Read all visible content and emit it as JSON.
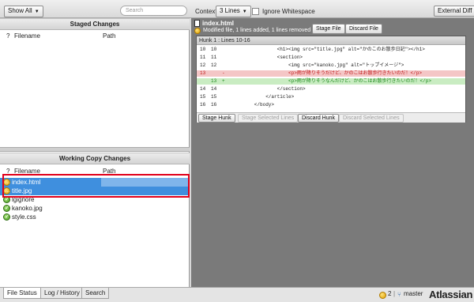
{
  "toolbar": {
    "show_filter": "Show All",
    "search_placeholder": "Search",
    "context_label": "Context:",
    "context_value": "3 Lines",
    "ignore_whitespace_label": "Ignore Whitespace",
    "external_diff_label": "External Diff"
  },
  "staged": {
    "title": "Staged Changes",
    "columns": {
      "q": "?",
      "filename": "Filename",
      "path": "Path"
    }
  },
  "working": {
    "title": "Working Copy Changes",
    "columns": {
      "q": "?",
      "filename": "Filename",
      "path": "Path"
    },
    "files": [
      {
        "name": "index.html",
        "status": "modified"
      },
      {
        "name": "title.jpg",
        "status": "modified"
      },
      {
        "name": "lgignore",
        "status": "clean"
      },
      {
        "name": "kanoko.jpg",
        "status": "clean"
      },
      {
        "name": "style.css",
        "status": "clean"
      }
    ]
  },
  "diff": {
    "file_name": "index.html",
    "summary": "Modified file, 1 lines added, 1 lines removed",
    "stage_file_label": "Stage File",
    "discard_file_label": "Discard File",
    "hunk_title": "Hunk 1 : Lines 10-16",
    "lines": [
      {
        "type": "context",
        "old": "10",
        "new": "10",
        "marker": "",
        "code": "                <h1><img src=\"title.jpg\" alt=\"かのこのお散歩日記\"></h1>"
      },
      {
        "type": "context",
        "old": "11",
        "new": "11",
        "marker": "",
        "code": "                <section>"
      },
      {
        "type": "context",
        "old": "12",
        "new": "12",
        "marker": "",
        "code": "                    <img src=\"kanoko.jpg\" alt=\"トップイメージ\">"
      },
      {
        "type": "removed",
        "old": "13",
        "new": "",
        "marker": "-",
        "code": "                    <p>雨が降りそうだけど、かのこはお散歩行きたいのだ！</p>"
      },
      {
        "type": "added",
        "old": "",
        "new": "13",
        "marker": "+",
        "code": "                    <p>雨が降りそうなんだけど、かのこはお散歩行きたいのだ！</p>"
      },
      {
        "type": "context",
        "old": "14",
        "new": "14",
        "marker": "",
        "code": "                </section>"
      },
      {
        "type": "context",
        "old": "15",
        "new": "15",
        "marker": "",
        "code": "            </article>"
      },
      {
        "type": "context",
        "old": "16",
        "new": "16",
        "marker": "",
        "code": "        </body>"
      }
    ],
    "stage_hunk_label": "Stage Hunk",
    "stage_selected_label": "Stage Selected Lines",
    "discard_hunk_label": "Discard Hunk",
    "discard_selected_label": "Discard Selected Lines"
  },
  "tabs": [
    "File Status",
    "Log / History",
    "Search"
  ],
  "status": {
    "pending_count": "2",
    "separator": "|",
    "branch": "master",
    "brand": "Atlassian"
  },
  "colors": {
    "selection": "#3f8fde",
    "highlight_box": "#e0001a",
    "removed_bg": "#f4c6c6",
    "added_bg": "#c9ecc2"
  }
}
